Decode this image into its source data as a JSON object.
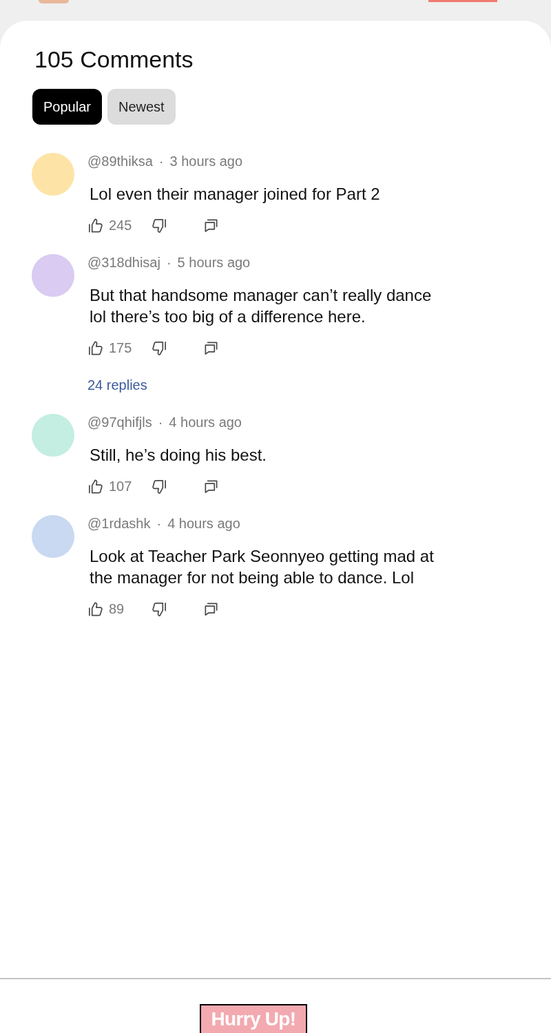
{
  "comments_section": {
    "title": "105 Comments",
    "sort_tabs": [
      {
        "label": "Popular",
        "selected": true
      },
      {
        "label": "Newest",
        "selected": false
      }
    ],
    "comments": [
      {
        "username": "@89thiksa",
        "separator": "·",
        "time": "3 hours ago",
        "color": "#fde4a6",
        "text": "Lol even their manager joined for Part 2",
        "likes": "245"
      },
      {
        "username": "@318dhisaj",
        "separator": "·",
        "time": "5 hours ago",
        "color": "#d9cbf1",
        "text": "But that handsome manager can’t really dance\nlol there’s too big of a difference here.",
        "likes": "175",
        "replies_link": "24 replies"
      },
      {
        "username": "@97qhifjls",
        "separator": "·",
        "time": "4 hours ago",
        "color": "#c3eee1",
        "text": "Still, he’s doing his best.",
        "likes": "107"
      },
      {
        "username": "@1rdashk",
        "separator": "·",
        "time": "4 hours ago",
        "color": "#c8d9f1",
        "text": "Look at Teacher Park Seonnyeo getting mad at\nthe manager for not being able to dance. Lol",
        "likes": "89"
      }
    ]
  },
  "next_panel": {
    "sign": "Hurry Up!"
  }
}
